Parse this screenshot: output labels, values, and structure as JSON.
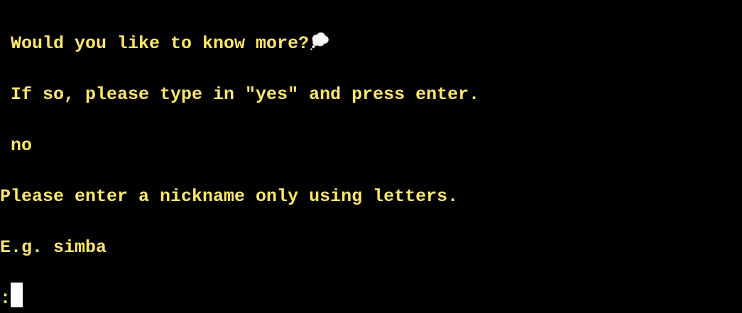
{
  "terminal": {
    "colors": {
      "background": "#000000",
      "text": "#ffe769",
      "cursor": "#ffffff"
    },
    "lines": [
      " Would you like to know more?",
      " If so, please type in \"yes\" and press enter.",
      " no",
      "Please enter a nickname only using letters.",
      "E.g. simba",
      ":"
    ],
    "icons": {
      "thought": "thought-balloon-icon"
    }
  }
}
